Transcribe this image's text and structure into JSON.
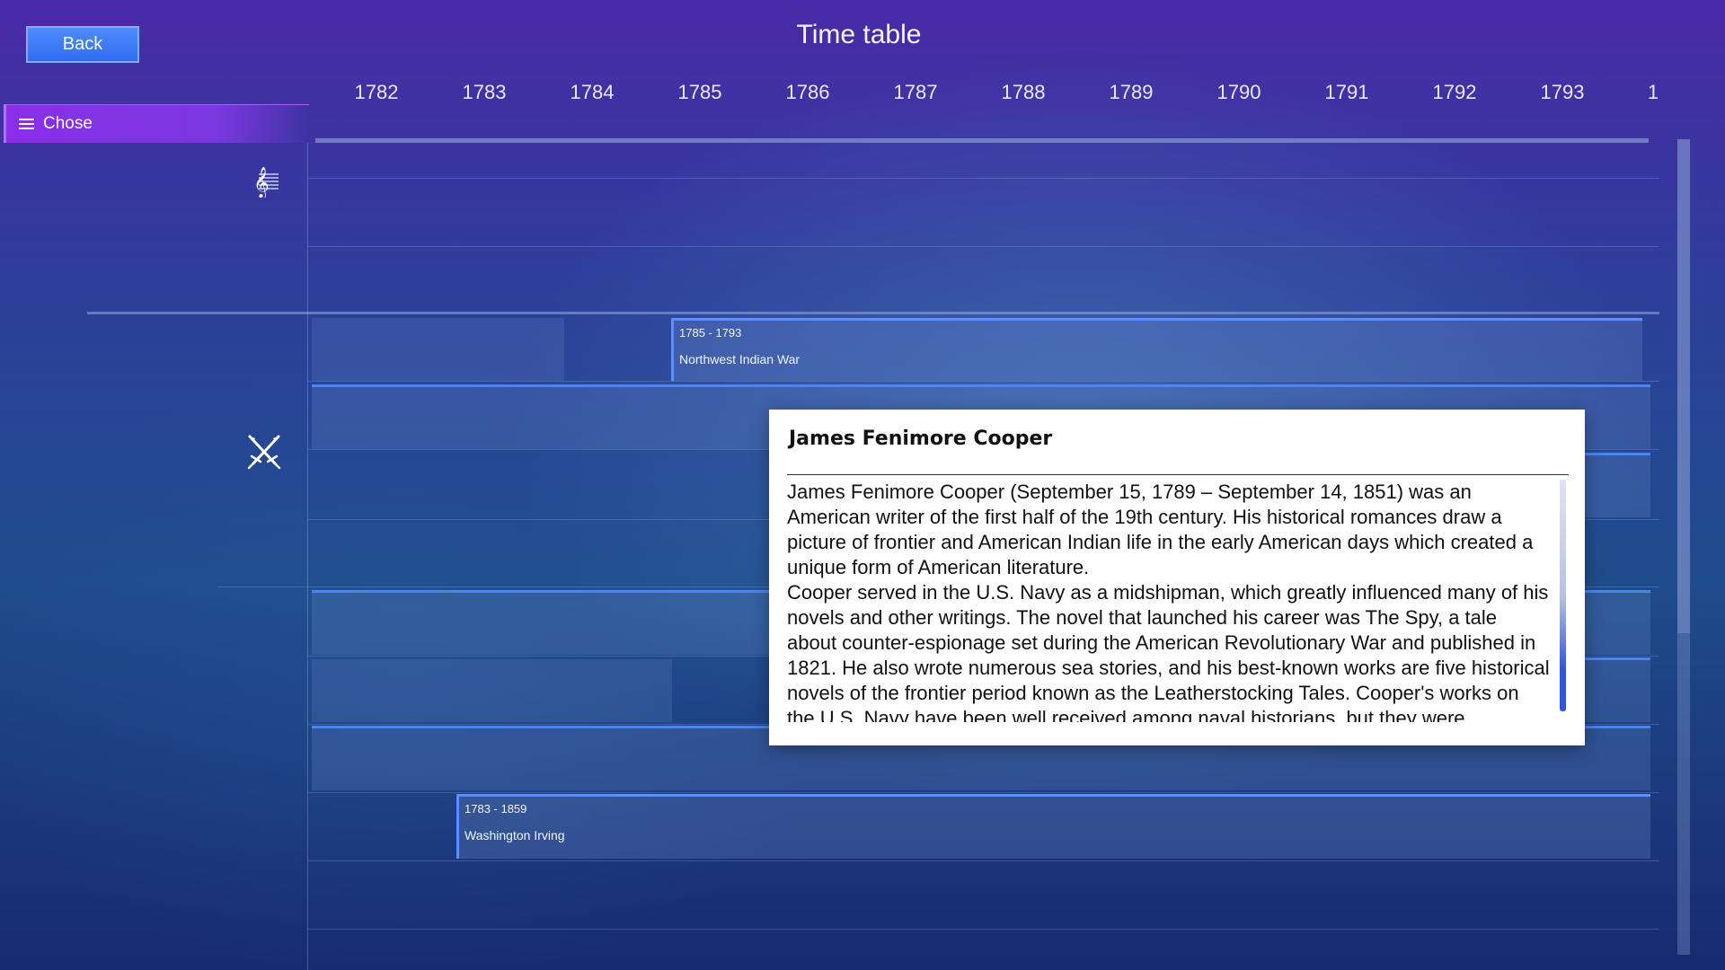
{
  "header": {
    "back_label": "Back",
    "title": "Time table"
  },
  "menu": {
    "chose_label": "Chose"
  },
  "timeline": {
    "years": [
      "1782",
      "1783",
      "1784",
      "1785",
      "1786",
      "1787",
      "1788",
      "1789",
      "1790",
      "1791",
      "1792",
      "1793",
      "1"
    ],
    "categories": [
      {
        "icon": "treble-clef-icon"
      },
      {
        "icon": "crossed-swords-icon"
      }
    ],
    "events": [
      {
        "years": "1785 - 1793",
        "name": "Northwest Indian War"
      },
      {
        "years": "1783 - 1859",
        "name": "Washington Irving"
      }
    ]
  },
  "popup": {
    "title": "James Fenimore Cooper",
    "body": "James Fenimore Cooper (September 15, 1789 – September 14, 1851) was an American writer of the first half of the 19th century. His historical romances draw a picture of frontier and American Indian life in the early American days which created a unique form of American literature.\n Cooper served in the U.S. Navy as a midshipman, which greatly influenced many of his novels and other writings. The novel that launched his career was The Spy, a tale about counter-espionage set during the American Revolutionary War and published in 1821. He also wrote numerous sea stories, and his best-known works are five historical novels of the frontier period known as the Leatherstocking Tales. Cooper's works on the U.S. Navy have been well received among naval historians, but they were sometimes criticized by"
  }
}
